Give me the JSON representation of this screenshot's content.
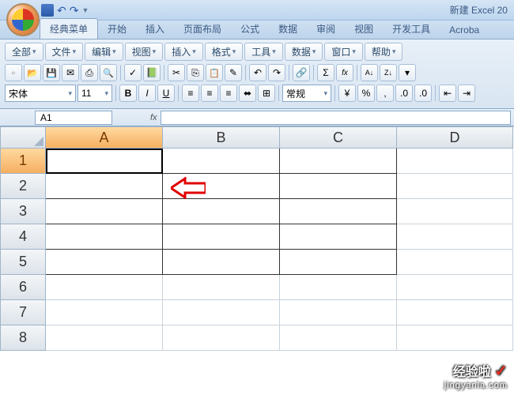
{
  "title": "新建 Excel 20",
  "tabs": [
    "经典菜单",
    "开始",
    "插入",
    "页面布局",
    "公式",
    "数据",
    "审阅",
    "视图",
    "开发工具",
    "Acroba"
  ],
  "active_tab": 0,
  "menus": [
    "全部",
    "文件",
    "编辑",
    "视图",
    "插入",
    "格式",
    "工具",
    "数据",
    "窗口",
    "帮助"
  ],
  "font": {
    "name": "宋体",
    "size": "11",
    "style_combo": "常规"
  },
  "namebox": "A1",
  "fx_label": "fx",
  "columns": [
    "A",
    "B",
    "C",
    "D"
  ],
  "rows": [
    "1",
    "2",
    "3",
    "4",
    "5",
    "6",
    "7",
    "8"
  ],
  "active_cell": {
    "row": 0,
    "col": 0
  },
  "bordered_range": {
    "rows": 5,
    "cols": 3
  },
  "watermark": {
    "main": "经验啦",
    "sub": "jingyanla.com"
  }
}
